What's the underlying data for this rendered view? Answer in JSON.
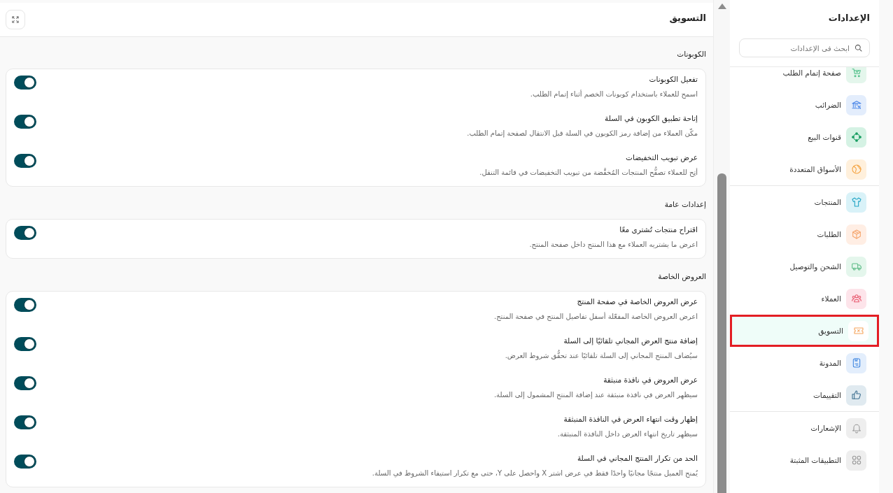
{
  "header": {
    "title": "التسويق"
  },
  "sections": [
    {
      "heading": "الكوبونات",
      "rows": [
        {
          "title": "تفعيل الكوبونات",
          "description": "اسمح للعملاء باستخدام كوبونات الخصم أثناء إتمام الطلب.",
          "on": true
        },
        {
          "title": "إتاحة تطبيق الكوبون في السلة",
          "description": "مكّن العملاء من إضافة رمز الكوبون في السلة قبل الانتقال لصفحة إتمام الطلب.",
          "on": true
        },
        {
          "title": "عرض تبويب التخفيضات",
          "description": "أتِح للعملاء تصفُّح المنتجات المُخفَّضة من تبويب التخفيضات في قائمة التنقل.",
          "on": true
        }
      ]
    },
    {
      "heading": "إعدادات عامة",
      "rows": [
        {
          "title": "اقتراح منتجات تُشترى معًا",
          "description": "اعرض ما يشتريه العملاء مع هذا المنتج داخل صفحة المنتج.",
          "on": true
        }
      ]
    },
    {
      "heading": "العروض الخاصة",
      "rows": [
        {
          "title": "عرض العروض الخاصة في صفحة المنتج",
          "description": "اعرض العروض الخاصة المفعّلة أسفل تفاصيل المنتج في صفحة المنتج.",
          "on": true
        },
        {
          "title": "إضافة منتج العرض المجاني تلقائيًا إلى السلة",
          "description": "سيُضاف المنتج المجاني إلى السلة تلقائيًا عند تحقُّق شروط العرض.",
          "on": true
        },
        {
          "title": "عرض العروض في نافذة منبثقة",
          "description": "سيظهر العرض في نافذة منبثقة عند إضافة المنتج المشمول إلى السلة.",
          "on": true
        },
        {
          "title": "إظهار وقت انتهاء العرض في النافذة المنبثقة",
          "description": "سيظهر تاريخ انتهاء العرض داخل النافذة المنبثقة.",
          "on": true
        },
        {
          "title": "الحد من تكرار المنتج المجاني في السلة",
          "description": "يُمنح العميل منتجًا مجانيًا واحدًا فقط في عرض اشتر X واحصل على Y، حتى مع تكرار استيفاء الشروط في السلة.",
          "on": true
        }
      ]
    }
  ],
  "sidebar": {
    "title": "الإعدادات",
    "search": {
      "placeholder": "ابحث في الإعدادات"
    },
    "groups": [
      {
        "items": [
          {
            "label": "صفحة إتمام الطلب",
            "selected": false,
            "color": "#e4f6ec"
          },
          {
            "label": "الضرائب",
            "selected": false,
            "color": "#e3edfc"
          },
          {
            "label": "قنوات البيع",
            "selected": false,
            "color": "#d5f2e4"
          },
          {
            "label": "الأسواق المتعددة",
            "selected": false,
            "color": "#fff0dc"
          }
        ]
      },
      {
        "items": [
          {
            "label": "المنتجات",
            "selected": false,
            "color": "#d9f2f8"
          },
          {
            "label": "الطلبات",
            "selected": false,
            "color": "#ffeee4"
          },
          {
            "label": "الشحن والتوصيل",
            "selected": false,
            "color": "#e4f6ec"
          },
          {
            "label": "العملاء",
            "selected": false,
            "color": "#fde4ea"
          },
          {
            "label": "التسويق",
            "selected": true,
            "color": "#ffffff"
          },
          {
            "label": "المدونة",
            "selected": false,
            "color": "#e3eefc"
          },
          {
            "label": "التقييمات",
            "selected": false,
            "color": "#e0eaf0"
          }
        ]
      },
      {
        "items": [
          {
            "label": "الإشعارات",
            "selected": false,
            "color": "#eeeeee"
          },
          {
            "label": "التطبيقات المثبتة",
            "selected": false,
            "color": "#eeeeee"
          }
        ]
      }
    ]
  }
}
